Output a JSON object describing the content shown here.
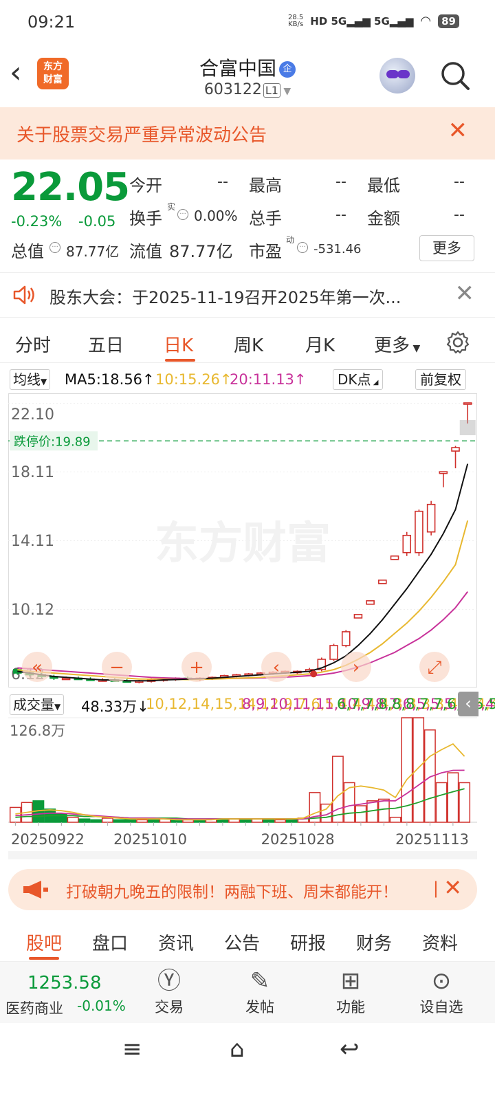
{
  "status": {
    "time": "09:21",
    "speed": "28.5\nKB/s",
    "net": "HD 5G 5G",
    "battery": "89"
  },
  "header": {
    "logo": "东方\n财富",
    "name": "合富中国",
    "name_badge": "企",
    "code": "603122",
    "level": "L1"
  },
  "alert": {
    "text": "关于股票交易严重异常波动公告"
  },
  "quote": {
    "price": "22.05",
    "change_pct": "-0.23%",
    "change": "-0.05",
    "open_label": "今开",
    "open": "--",
    "high_label": "最高",
    "high": "--",
    "low_label": "最低",
    "low": "--",
    "turnover_label": "换手",
    "turnover_sup": "实",
    "turnover": "0.00%",
    "volume_label": "总手",
    "volume": "--",
    "amount_label": "金额",
    "amount": "--",
    "mktcap_label": "总值",
    "mktcap": "87.77亿",
    "float_label": "流值",
    "float": "87.77亿",
    "pe_label": "市盈",
    "pe_sup": "动",
    "pe": "-531.46",
    "more": "更多"
  },
  "notice": {
    "text": "股东大会：于2025-11-19召开2025年第一次..."
  },
  "tabs": [
    "分时",
    "五日",
    "日K",
    "周K",
    "月K",
    "更多"
  ],
  "ma": {
    "selector": "均线",
    "ma5": "MA5:18.56↑",
    "ma10": "10:15.26↑",
    "ma20": "20:11.13↑",
    "dk": "DK点",
    "adjust": "前复权"
  },
  "colors": {
    "up": "#d0302c",
    "down": "#0a9a3a",
    "accent": "#e8572a",
    "ma5": "#111111",
    "ma10": "#e8b830",
    "ma20": "#c8329a",
    "ma3": "#22a02c"
  },
  "chart_data": {
    "type": "candlestick",
    "y_ticks": [
      "22.10",
      "18.11",
      "14.11",
      "10.12",
      "6.12"
    ],
    "limit_down_label": "跌停价:19.89",
    "watermark": "东方财富",
    "candles": [
      [
        6.6,
        6.7,
        6.3,
        6.4
      ],
      [
        6.4,
        6.5,
        6.2,
        6.3
      ],
      [
        6.3,
        6.4,
        6.1,
        6.2
      ],
      [
        6.2,
        6.3,
        6.0,
        6.1
      ],
      [
        6.1,
        6.2,
        6.0,
        6.1
      ],
      [
        6.1,
        6.2,
        6.0,
        6.05
      ],
      [
        6.05,
        6.15,
        5.95,
        6.0
      ],
      [
        6.0,
        6.1,
        5.9,
        6.0
      ],
      [
        6.0,
        6.1,
        5.9,
        5.95
      ],
      [
        5.95,
        6.05,
        5.85,
        5.9
      ],
      [
        5.9,
        6.0,
        5.8,
        5.95
      ],
      [
        5.95,
        6.1,
        5.85,
        6.0
      ],
      [
        6.0,
        6.1,
        5.9,
        6.05
      ],
      [
        6.05,
        6.15,
        5.95,
        6.1
      ],
      [
        6.1,
        6.2,
        6.0,
        6.05
      ],
      [
        6.05,
        6.15,
        5.95,
        6.1
      ],
      [
        6.1,
        6.2,
        6.0,
        6.15
      ],
      [
        6.15,
        6.3,
        6.1,
        6.25
      ],
      [
        6.25,
        6.35,
        6.15,
        6.3
      ],
      [
        6.3,
        6.4,
        6.2,
        6.35
      ],
      [
        6.35,
        6.45,
        6.25,
        6.4
      ],
      [
        6.4,
        6.5,
        6.3,
        6.45
      ],
      [
        6.45,
        6.55,
        6.35,
        6.5
      ],
      [
        6.45,
        6.55,
        6.35,
        6.5
      ],
      [
        6.5,
        6.7,
        6.4,
        6.6
      ],
      [
        6.6,
        7.3,
        6.5,
        7.2
      ],
      [
        7.2,
        8.1,
        7.1,
        8.0
      ],
      [
        8.0,
        8.9,
        7.9,
        8.8
      ],
      [
        9.6,
        9.8,
        9.6,
        9.8
      ],
      [
        10.4,
        10.6,
        10.4,
        10.6
      ],
      [
        11.6,
        11.8,
        11.6,
        11.8
      ],
      [
        13.0,
        13.2,
        13.0,
        13.2
      ],
      [
        13.4,
        14.6,
        13.2,
        14.4
      ],
      [
        13.4,
        15.9,
        13.2,
        15.8
      ],
      [
        14.6,
        16.4,
        14.4,
        16.2
      ],
      [
        18.0,
        18.1,
        17.2,
        18.1
      ],
      [
        19.3,
        19.6,
        18.3,
        19.5
      ],
      [
        22.1,
        22.1,
        20.9,
        22.1
      ]
    ],
    "ma5": [
      6.5,
      6.4,
      6.3,
      6.2,
      6.15,
      6.1,
      6.05,
      6.0,
      6.0,
      5.95,
      5.95,
      5.95,
      6.0,
      6.02,
      6.05,
      6.07,
      6.1,
      6.15,
      6.2,
      6.25,
      6.3,
      6.35,
      6.4,
      6.45,
      6.5,
      6.7,
      7.0,
      7.4,
      8.0,
      8.7,
      9.5,
      10.4,
      11.3,
      12.3,
      13.3,
      14.5,
      15.9,
      18.56
    ],
    "ma10": [
      6.6,
      6.5,
      6.45,
      6.4,
      6.35,
      6.3,
      6.25,
      6.2,
      6.15,
      6.1,
      6.05,
      6.05,
      6.05,
      6.03,
      6.02,
      6.03,
      6.05,
      6.07,
      6.1,
      6.12,
      6.15,
      6.2,
      6.25,
      6.3,
      6.35,
      6.45,
      6.6,
      6.85,
      7.2,
      7.6,
      8.1,
      8.7,
      9.3,
      10.0,
      10.8,
      11.7,
      12.7,
      15.26
    ],
    "ma20": [
      6.7,
      6.65,
      6.6,
      6.55,
      6.5,
      6.45,
      6.4,
      6.35,
      6.3,
      6.25,
      6.2,
      6.15,
      6.12,
      6.1,
      6.08,
      6.07,
      6.07,
      6.08,
      6.09,
      6.1,
      6.12,
      6.14,
      6.16,
      6.2,
      6.25,
      6.3,
      6.4,
      6.55,
      6.75,
      7.0,
      7.3,
      7.6,
      8.0,
      8.4,
      8.9,
      9.5,
      10.2,
      11.13
    ]
  },
  "volume": {
    "selector": "成交量",
    "value": "48.33万↓",
    "ma1": [
      10,
      12,
      14,
      15,
      14,
      12,
      9,
      7,
      6,
      5,
      4,
      4,
      4,
      4,
      3,
      3,
      3,
      3,
      4,
      4,
      4,
      4,
      4,
      4,
      4,
      5,
      11,
      16,
      32,
      42,
      44,
      42,
      39,
      30,
      52,
      66,
      80,
      88,
      95,
      80.04
    ],
    "ma2": [
      8,
      9,
      10,
      11,
      11,
      10,
      9,
      8,
      7,
      6,
      5,
      5,
      5,
      4,
      4,
      4,
      4,
      4,
      4,
      4,
      4,
      4,
      4,
      4,
      4,
      4,
      7,
      9,
      16,
      20,
      22,
      24,
      26,
      26,
      35,
      45,
      55,
      60,
      63,
      63.09
    ],
    "ma3": [
      6,
      7,
      7,
      8,
      8,
      8,
      7,
      7,
      6,
      6,
      5,
      5,
      5,
      5,
      5,
      4,
      4,
      4,
      4,
      4,
      4,
      4,
      4,
      4,
      4,
      4,
      5,
      6,
      9,
      11,
      12,
      14,
      16,
      17,
      20,
      24,
      29,
      33,
      37,
      40.6
    ],
    "max_label": "126.8万",
    "dates": [
      "20250922",
      "20251010",
      "20251028",
      "20251113"
    ],
    "bars": [
      [
        18,
        1
      ],
      [
        24,
        1
      ],
      [
        26,
        0
      ],
      [
        16,
        0
      ],
      [
        10,
        0
      ],
      [
        6,
        1
      ],
      [
        4,
        0
      ],
      [
        3,
        0
      ],
      [
        5,
        1
      ],
      [
        3,
        0
      ],
      [
        4,
        0
      ],
      [
        3,
        1
      ],
      [
        3,
        0
      ],
      [
        4,
        1
      ],
      [
        3,
        0
      ],
      [
        3,
        1
      ],
      [
        3,
        0
      ],
      [
        4,
        1
      ],
      [
        4,
        0
      ],
      [
        4,
        1
      ],
      [
        3,
        0
      ],
      [
        4,
        1
      ],
      [
        4,
        0
      ],
      [
        3,
        1
      ],
      [
        4,
        0
      ],
      [
        5,
        1
      ],
      [
        36,
        1
      ],
      [
        22,
        1
      ],
      [
        80,
        1
      ],
      [
        48,
        1
      ],
      [
        20,
        1
      ],
      [
        26,
        1
      ],
      [
        28,
        1
      ],
      [
        6,
        1
      ],
      [
        126.8,
        1
      ],
      [
        126.8,
        1
      ],
      [
        112,
        1
      ],
      [
        48,
        1
      ],
      [
        60,
        1
      ],
      [
        48,
        1
      ]
    ]
  },
  "ad": {
    "text": "打破朝九晚五的限制！两融下班、周末都能开！"
  },
  "bottom_tabs": [
    "股吧",
    "盘口",
    "资讯",
    "公告",
    "研报",
    "财务",
    "资料"
  ],
  "bottom_bar": {
    "index_value": "1253.58",
    "index_name": "医药商业",
    "index_change": "-0.01%",
    "buttons": [
      "交易",
      "发帖",
      "功能",
      "设自选"
    ]
  }
}
